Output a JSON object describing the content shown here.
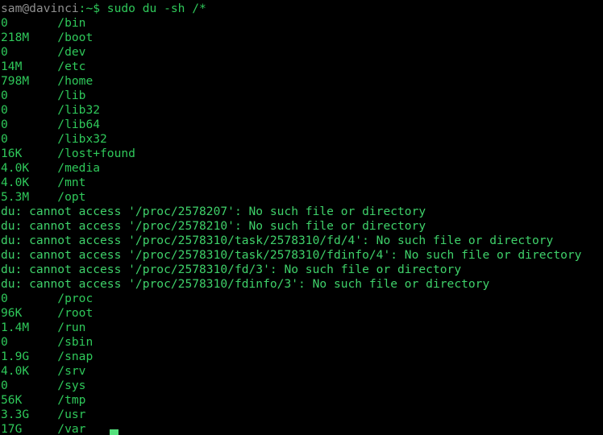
{
  "terminal": {
    "background_color": "#000000",
    "text_color": "#2fc85a",
    "host_color": "#8f8f8f",
    "cursor_color": "#54e07c",
    "prompt": {
      "host": "sam@davinci",
      "rest": ":~$",
      "command": " sudo du -sh /*",
      "full_line": "sam@davinci:~$ sudo du -sh /*"
    },
    "entries": [
      {
        "size": "0",
        "path": "/bin"
      },
      {
        "size": "218M",
        "path": "/boot"
      },
      {
        "size": "0",
        "path": "/dev"
      },
      {
        "size": "14M",
        "path": "/etc"
      },
      {
        "size": "798M",
        "path": "/home"
      },
      {
        "size": "0",
        "path": "/lib"
      },
      {
        "size": "0",
        "path": "/lib32"
      },
      {
        "size": "0",
        "path": "/lib64"
      },
      {
        "size": "0",
        "path": "/libx32"
      },
      {
        "size": "16K",
        "path": "/lost+found"
      },
      {
        "size": "4.0K",
        "path": "/media"
      },
      {
        "size": "4.0K",
        "path": "/mnt"
      },
      {
        "size": "5.3M",
        "path": "/opt"
      }
    ],
    "errors": [
      "du: cannot access '/proc/2578207': No such file or directory",
      "du: cannot access '/proc/2578210': No such file or directory",
      "du: cannot access '/proc/2578310/task/2578310/fd/4': No such file or directory",
      "du: cannot access '/proc/2578310/task/2578310/fdinfo/4': No such file or directory",
      "du: cannot access '/proc/2578310/fd/3': No such file or directory",
      "du: cannot access '/proc/2578310/fdinfo/3': No such file or directory"
    ],
    "entries_after": [
      {
        "size": "0",
        "path": "/proc"
      },
      {
        "size": "96K",
        "path": "/root"
      },
      {
        "size": "1.4M",
        "path": "/run"
      },
      {
        "size": "0",
        "path": "/sbin"
      },
      {
        "size": "1.9G",
        "path": "/snap"
      },
      {
        "size": "4.0K",
        "path": "/srv"
      },
      {
        "size": "0",
        "path": "/sys"
      },
      {
        "size": "56K",
        "path": "/tmp"
      },
      {
        "size": "3.3G",
        "path": "/usr"
      },
      {
        "size": "17G",
        "path": "/var"
      }
    ]
  }
}
